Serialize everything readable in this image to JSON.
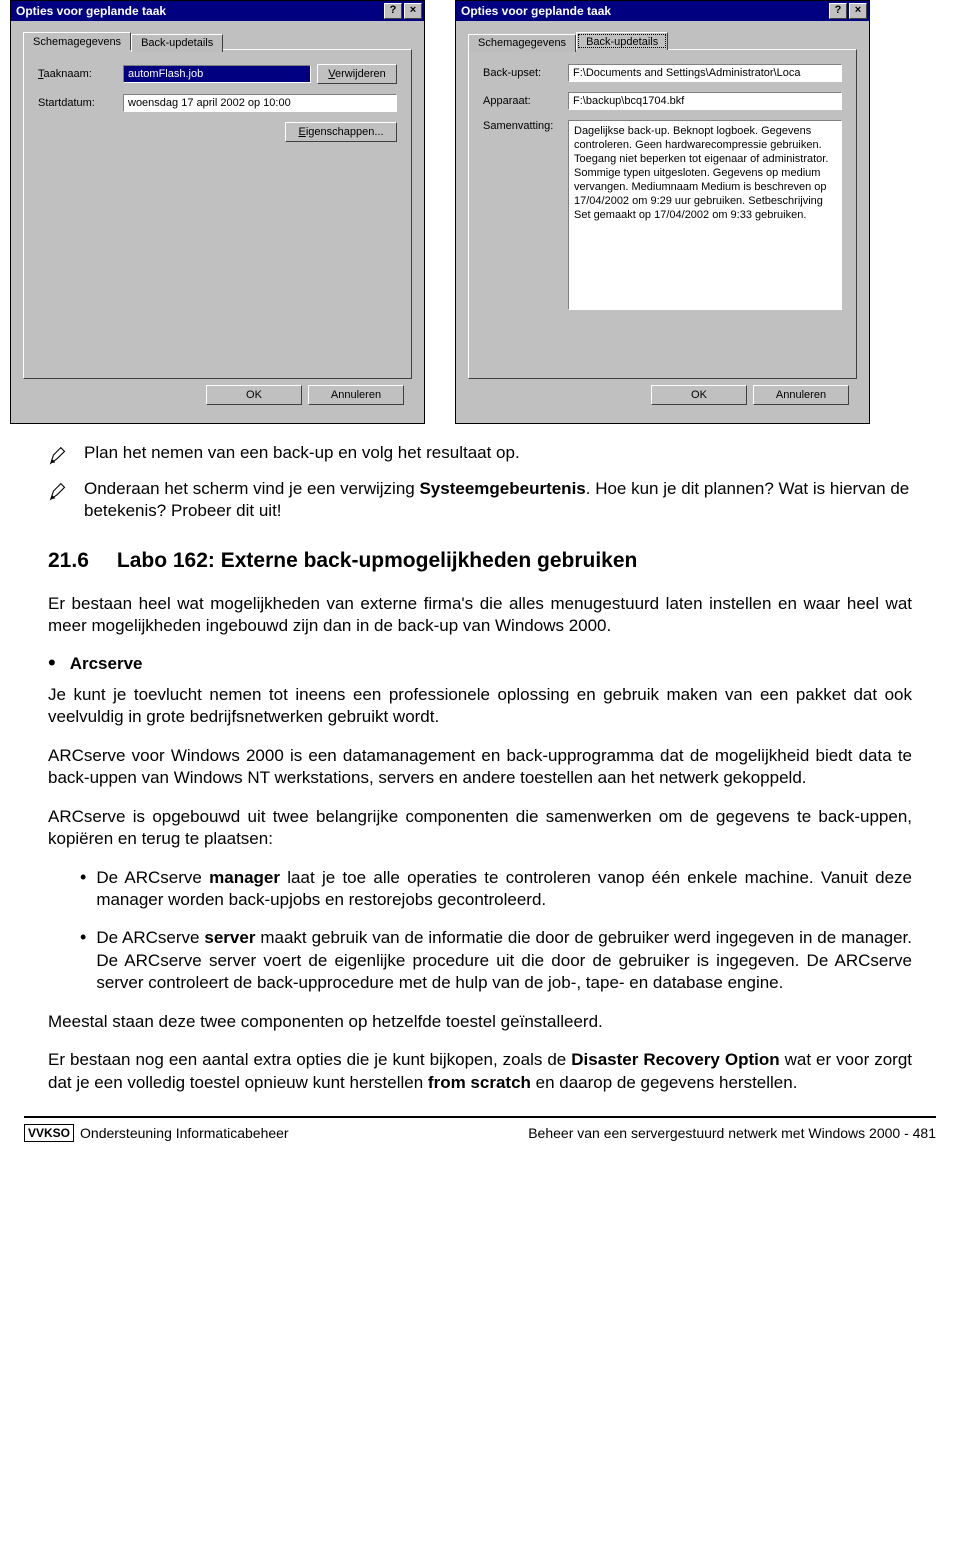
{
  "dialog_left": {
    "title": "Opties voor geplande taak",
    "tabs": {
      "active": "Schemagegevens",
      "inactive": "Back-updetails"
    },
    "taaknaam_label": "Taaknaam:",
    "taaknaam_value": "automFlash.job",
    "startdatum_label": "Startdatum:",
    "startdatum_value": "woensdag 17 april 2002 op 10:00",
    "verwijderen": "Verwijderen",
    "eigenschappen": "Eigenschappen...",
    "ok": "OK",
    "annuleren": "Annuleren"
  },
  "dialog_right": {
    "title": "Opties voor geplande taak",
    "tabs": {
      "inactive": "Schemagegevens",
      "active": "Back-updetails"
    },
    "backupset_label": "Back-upset:",
    "backupset_value": "F:\\Documents and Settings\\Administrator\\Loca",
    "apparaat_label": "Apparaat:",
    "apparaat_value": "F:\\backup\\bcq1704.bkf",
    "samenvatting_label": "Samenvatting:",
    "samenvatting_value": "Dagelijkse back-up. Beknopt logboek. Gegevens controleren. Geen hardwarecompressie gebruiken. Toegang niet beperken tot eigenaar of administrator. Sommige typen uitgesloten. Gegevens op medium vervangen. Mediumnaam Medium is beschreven op 17/04/2002 om 9:29 uur gebruiken. Setbeschrijving Set gemaakt op 17/04/2002 om 9:33 gebruiken.",
    "ok": "OK",
    "annuleren": "Annuleren"
  },
  "doc": {
    "pen1": "Plan het nemen van een back-up en volg het resultaat op.",
    "pen2_a": "Onderaan het scherm vind je een verwijzing ",
    "pen2_bold": "Systeemgebeurtenis",
    "pen2_b": ". Hoe kun je dit plannen? Wat is hiervan de betekenis? Probeer dit uit!",
    "h_num": "21.6",
    "h_txt": "Labo 162: Externe back-upmogelijkheden gebruiken",
    "intro": "Er bestaan heel wat mogelijkheden van externe firma's die alles menugestuurd laten instellen en waar heel wat meer mogelijkheden ingebouwd zijn dan in de back-up van Windows 2000.",
    "arcserve": "Arcserve",
    "p1": "Je kunt je toevlucht nemen tot ineens een professionele oplossing en gebruik maken van een pakket dat ook veelvuldig in grote bedrijfsnetwerken gebruikt wordt.",
    "p2": "ARCserve voor Windows 2000 is een datamanagement en back-upprogramma dat de mogelijkheid biedt data te back-uppen van Windows NT werkstations, servers en andere toestellen aan het netwerk gekoppeld.",
    "p3": "ARCserve is opgebouwd uit twee belangrijke componenten die samenwerken om de gegevens te back-uppen, kopiëren en terug te plaatsen:",
    "li1_a": "De ARCserve ",
    "li1_bold": "manager",
    "li1_b": " laat je toe alle operaties te controleren vanop één enkele machine. Vanuit deze manager worden back-upjobs en restorejobs gecontroleerd.",
    "li2_a": "De ARCserve ",
    "li2_bold": "server",
    "li2_b": " maakt gebruik van de informatie die door de gebruiker werd ingegeven in de manager. De ARCserve server voert de eigenlijke procedure uit die door de gebruiker is ingegeven. De ARCserve server controleert de back-upprocedure met de hulp van de job-, tape- en database engine.",
    "p4": "Meestal staan deze twee componenten op hetzelfde toestel geïnstalleerd.",
    "p5_a": "Er bestaan nog een aantal extra opties die je kunt bijkopen, zoals de ",
    "p5_bold1": "Disaster Recovery Option",
    "p5_b": " wat er voor zorgt dat je een volledig toestel opnieuw kunt herstellen ",
    "p5_bold2": "from scratch",
    "p5_c": " en daarop de gegevens herstellen."
  },
  "footer": {
    "vvkso": "VVKSO",
    "left": "Ondersteuning Informaticabeheer",
    "right": "Beheer van een servergestuurd netwerk met Windows 2000 -  481"
  }
}
